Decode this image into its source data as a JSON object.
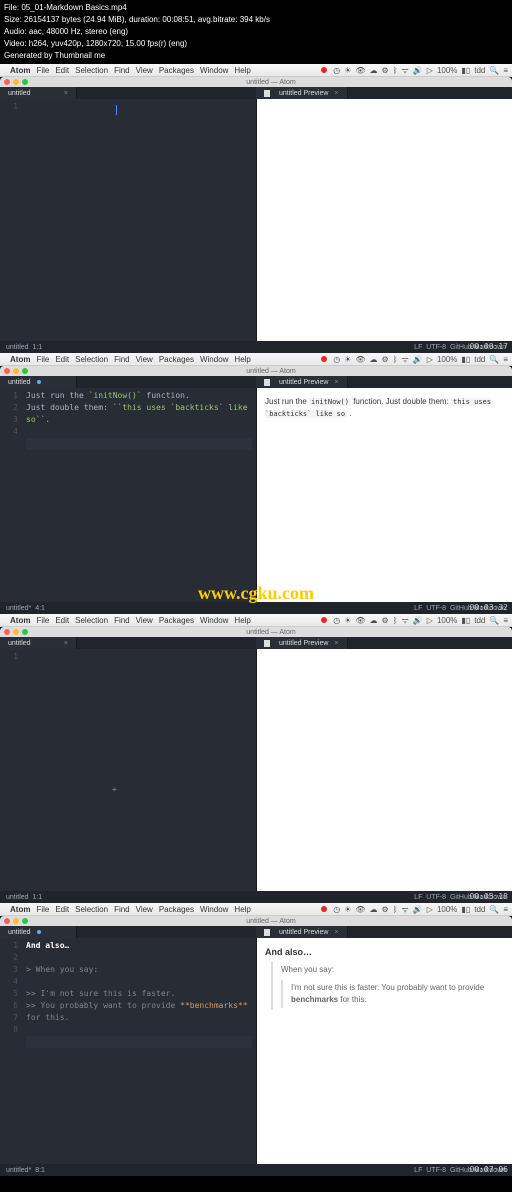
{
  "metadata": {
    "file": "File: 05_01-Markdown Basics.mp4",
    "size": "Size: 26154137 bytes (24.94 MiB), duration: 00:08:51, avg.bitrate: 394 kb/s",
    "audio": "Audio: aac, 48000 Hz, stereo (eng)",
    "video": "Video: h264, yuv420p, 1280x720, 15.00 fps(r) (eng)",
    "gen": "Generated by Thumbnail me"
  },
  "menubar": {
    "apple": "",
    "atom": "Atom",
    "file": "File",
    "edit": "Edit",
    "selection": "Selection",
    "find": "Find",
    "view": "View",
    "packages": "Packages",
    "window": "Window",
    "help": "Help",
    "battery": "100%",
    "user": "tdd"
  },
  "window": {
    "title": "untitled — Atom",
    "tab_untitled": "untitled",
    "tab_untitled_mod": "untitled",
    "tab_preview": "untitled Preview",
    "tab_close": "×"
  },
  "status": {
    "left1": "untitled",
    "left1b": "untitled*",
    "pos11": "1:1",
    "pos41": "4:1",
    "pos81": "8:1",
    "lf": "LF",
    "utf8": "UTF-8",
    "md": "GitHub Markdown"
  },
  "frames": {
    "f1": {
      "ts": "00:00:17"
    },
    "f2": {
      "ts": "00:03:32",
      "line1": {
        "a": "Just run the ",
        "b": "`initNow()`",
        "c": " function."
      },
      "line2": {
        "a": "Just double them: ",
        "b": "``this uses `backticks` like so``",
        "c": "."
      },
      "preview": {
        "a": "Just run the ",
        "code1": "initNow()",
        "b": " function. Just double them: ",
        "code2": "this uses `backticks` like so",
        "c": " ."
      }
    },
    "f3": {
      "ts": "00:05:18"
    },
    "f4": {
      "ts": "00:07:06",
      "line1": "And also…",
      "line3": "> When you say:",
      "line5": ">> I'm not sure this is faster.",
      "line6a": ">> You probably want to provide ",
      "line6b": "**benchmarks**",
      "line6c": " for this.",
      "preview": {
        "h": "And also…",
        "q1": "When you say:",
        "q2a": "I'm not sure this is faster. You probably want to provide ",
        "q2b": "benchmarks",
        "q2c": " for this."
      }
    }
  },
  "watermark": "www.cgku.com",
  "icons": {
    "wifi": "ᯤ",
    "bt": "ᛒ",
    "vol": "🔊",
    "search": "🔍",
    "menu": "≡",
    "bat": "▮▯",
    "clock": "◷",
    "cloud": "☁",
    "eye": "👁",
    "play": "▷",
    "gear": "⚙",
    "sun": "☀"
  },
  "chart_data": null
}
